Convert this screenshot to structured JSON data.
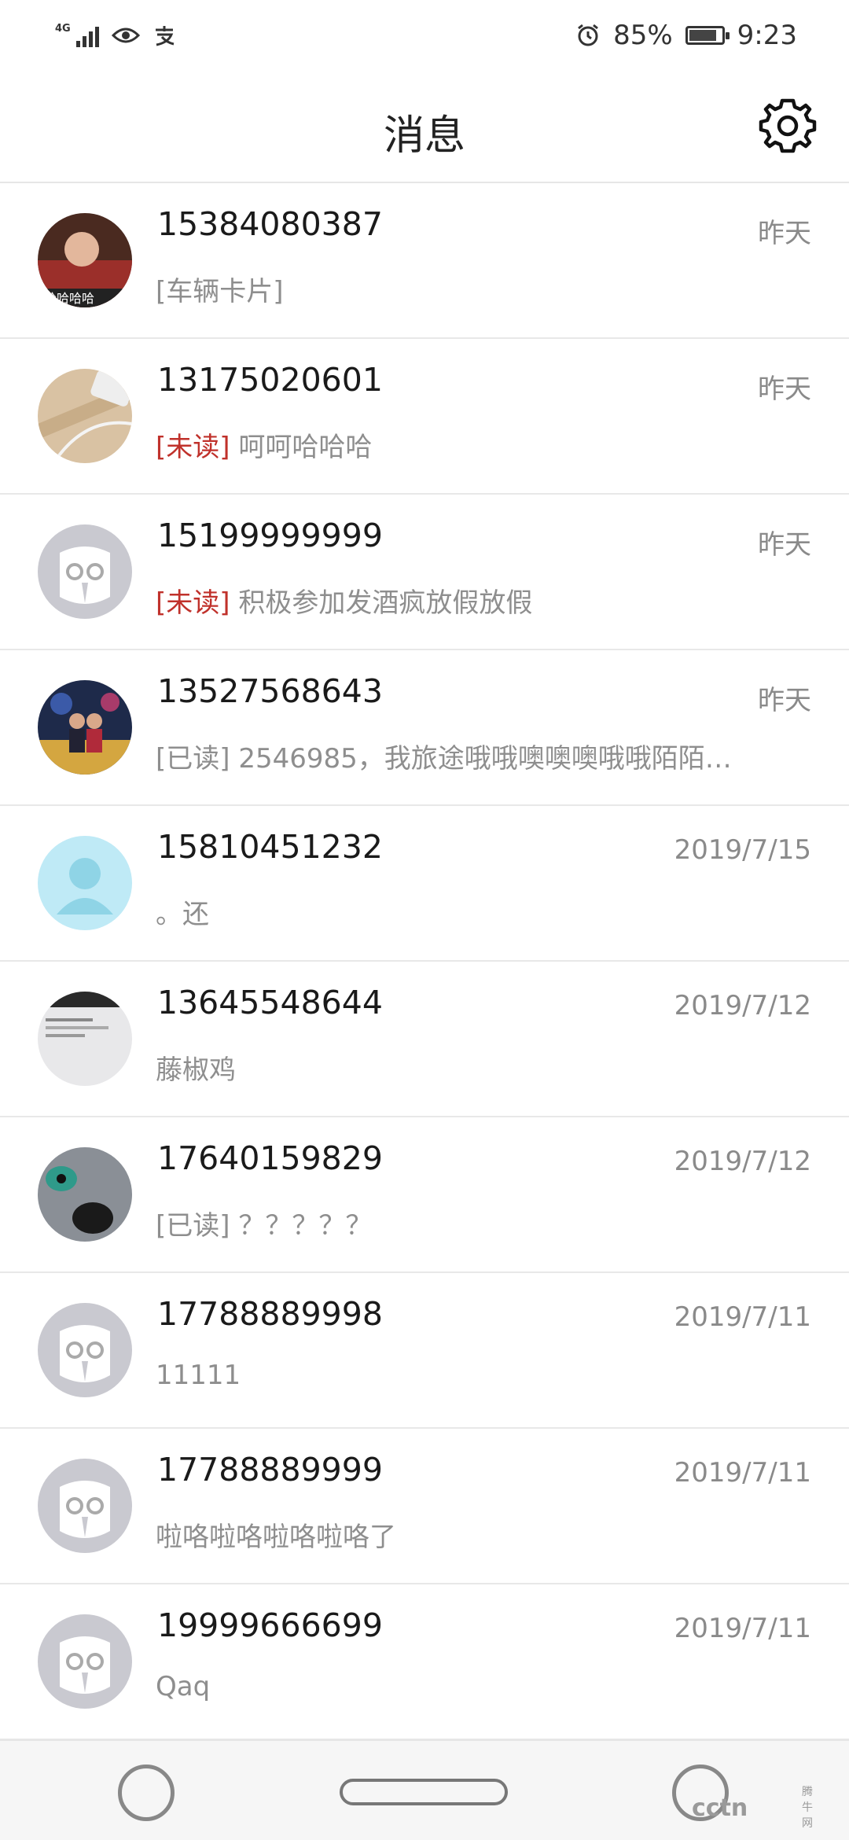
{
  "status_bar": {
    "network": "4G",
    "battery": "85%",
    "battery_level": 0.85,
    "time": "9:23"
  },
  "header": {
    "title": "消息",
    "settings_icon": "gear-icon"
  },
  "conversations": [
    {
      "phone": "15384080387",
      "time": "昨天",
      "tag": "",
      "tag_type": "",
      "preview": "[车辆卡片]",
      "avatar": "photo-person"
    },
    {
      "phone": "13175020601",
      "time": "昨天",
      "tag": "[未读]",
      "tag_type": "unread",
      "preview": "呵呵哈哈哈",
      "avatar": "photo-desk"
    },
    {
      "phone": "15199999999",
      "time": "昨天",
      "tag": "[未读]",
      "tag_type": "unread",
      "preview": "积极参加发酒疯放假放假",
      "avatar": "default-owl"
    },
    {
      "phone": "13527568643",
      "time": "昨天",
      "tag": "[已读]",
      "tag_type": "read",
      "preview": "2546985，我旅途哦哦噢噢噢哦哦陌陌…",
      "avatar": "photo-couple"
    },
    {
      "phone": "15810451232",
      "time": "2019/7/15",
      "tag": "",
      "tag_type": "",
      "preview": "。还",
      "avatar": "default-person"
    },
    {
      "phone": "13645548644",
      "time": "2019/7/12",
      "tag": "",
      "tag_type": "",
      "preview": "藤椒鸡",
      "avatar": "photo-screen"
    },
    {
      "phone": "17640159829",
      "time": "2019/7/12",
      "tag": "[已读]",
      "tag_type": "read",
      "preview": "？？？？？",
      "avatar": "photo-cat"
    },
    {
      "phone": "17788889998",
      "time": "2019/7/11",
      "tag": "",
      "tag_type": "",
      "preview": "11111",
      "avatar": "default-owl"
    },
    {
      "phone": "17788889999",
      "time": "2019/7/11",
      "tag": "",
      "tag_type": "",
      "preview": "啦咯啦咯啦咯啦咯了",
      "avatar": "default-owl"
    },
    {
      "phone": "19999666699",
      "time": "2019/7/11",
      "tag": "",
      "tag_type": "",
      "preview": "Qaq",
      "avatar": "default-owl"
    }
  ],
  "watermark": {
    "text": "cctn",
    "sub": "腾牛网"
  },
  "colors": {
    "unread": "#c0312b",
    "muted": "#8e8e8e",
    "divider": "#e8e8e8"
  }
}
